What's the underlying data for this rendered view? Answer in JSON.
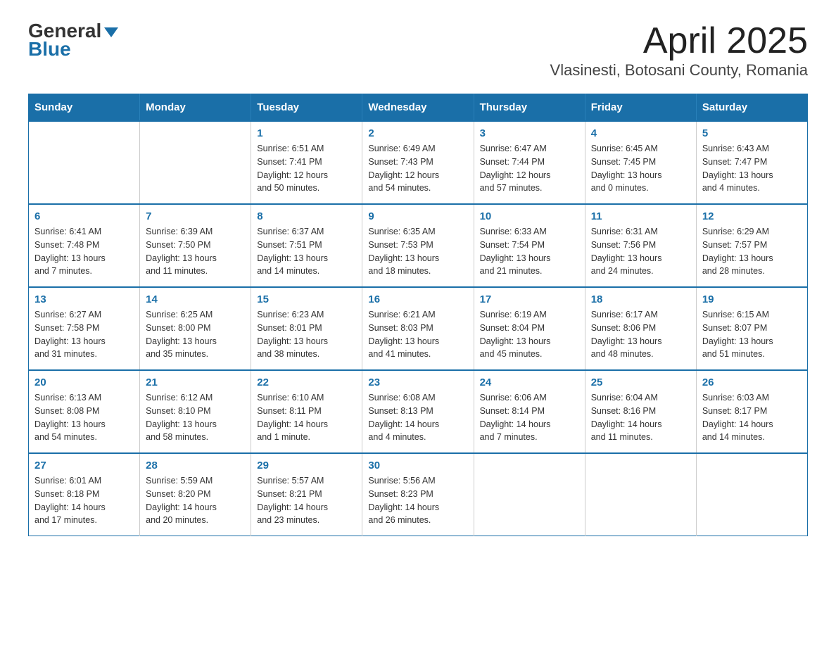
{
  "header": {
    "logo_line1": "General",
    "logo_line2": "Blue",
    "title": "April 2025",
    "subtitle": "Vlasinesti, Botosani County, Romania"
  },
  "calendar": {
    "days_of_week": [
      "Sunday",
      "Monday",
      "Tuesday",
      "Wednesday",
      "Thursday",
      "Friday",
      "Saturday"
    ],
    "weeks": [
      [
        {
          "day": "",
          "info": ""
        },
        {
          "day": "",
          "info": ""
        },
        {
          "day": "1",
          "info": "Sunrise: 6:51 AM\nSunset: 7:41 PM\nDaylight: 12 hours\nand 50 minutes."
        },
        {
          "day": "2",
          "info": "Sunrise: 6:49 AM\nSunset: 7:43 PM\nDaylight: 12 hours\nand 54 minutes."
        },
        {
          "day": "3",
          "info": "Sunrise: 6:47 AM\nSunset: 7:44 PM\nDaylight: 12 hours\nand 57 minutes."
        },
        {
          "day": "4",
          "info": "Sunrise: 6:45 AM\nSunset: 7:45 PM\nDaylight: 13 hours\nand 0 minutes."
        },
        {
          "day": "5",
          "info": "Sunrise: 6:43 AM\nSunset: 7:47 PM\nDaylight: 13 hours\nand 4 minutes."
        }
      ],
      [
        {
          "day": "6",
          "info": "Sunrise: 6:41 AM\nSunset: 7:48 PM\nDaylight: 13 hours\nand 7 minutes."
        },
        {
          "day": "7",
          "info": "Sunrise: 6:39 AM\nSunset: 7:50 PM\nDaylight: 13 hours\nand 11 minutes."
        },
        {
          "day": "8",
          "info": "Sunrise: 6:37 AM\nSunset: 7:51 PM\nDaylight: 13 hours\nand 14 minutes."
        },
        {
          "day": "9",
          "info": "Sunrise: 6:35 AM\nSunset: 7:53 PM\nDaylight: 13 hours\nand 18 minutes."
        },
        {
          "day": "10",
          "info": "Sunrise: 6:33 AM\nSunset: 7:54 PM\nDaylight: 13 hours\nand 21 minutes."
        },
        {
          "day": "11",
          "info": "Sunrise: 6:31 AM\nSunset: 7:56 PM\nDaylight: 13 hours\nand 24 minutes."
        },
        {
          "day": "12",
          "info": "Sunrise: 6:29 AM\nSunset: 7:57 PM\nDaylight: 13 hours\nand 28 minutes."
        }
      ],
      [
        {
          "day": "13",
          "info": "Sunrise: 6:27 AM\nSunset: 7:58 PM\nDaylight: 13 hours\nand 31 minutes."
        },
        {
          "day": "14",
          "info": "Sunrise: 6:25 AM\nSunset: 8:00 PM\nDaylight: 13 hours\nand 35 minutes."
        },
        {
          "day": "15",
          "info": "Sunrise: 6:23 AM\nSunset: 8:01 PM\nDaylight: 13 hours\nand 38 minutes."
        },
        {
          "day": "16",
          "info": "Sunrise: 6:21 AM\nSunset: 8:03 PM\nDaylight: 13 hours\nand 41 minutes."
        },
        {
          "day": "17",
          "info": "Sunrise: 6:19 AM\nSunset: 8:04 PM\nDaylight: 13 hours\nand 45 minutes."
        },
        {
          "day": "18",
          "info": "Sunrise: 6:17 AM\nSunset: 8:06 PM\nDaylight: 13 hours\nand 48 minutes."
        },
        {
          "day": "19",
          "info": "Sunrise: 6:15 AM\nSunset: 8:07 PM\nDaylight: 13 hours\nand 51 minutes."
        }
      ],
      [
        {
          "day": "20",
          "info": "Sunrise: 6:13 AM\nSunset: 8:08 PM\nDaylight: 13 hours\nand 54 minutes."
        },
        {
          "day": "21",
          "info": "Sunrise: 6:12 AM\nSunset: 8:10 PM\nDaylight: 13 hours\nand 58 minutes."
        },
        {
          "day": "22",
          "info": "Sunrise: 6:10 AM\nSunset: 8:11 PM\nDaylight: 14 hours\nand 1 minute."
        },
        {
          "day": "23",
          "info": "Sunrise: 6:08 AM\nSunset: 8:13 PM\nDaylight: 14 hours\nand 4 minutes."
        },
        {
          "day": "24",
          "info": "Sunrise: 6:06 AM\nSunset: 8:14 PM\nDaylight: 14 hours\nand 7 minutes."
        },
        {
          "day": "25",
          "info": "Sunrise: 6:04 AM\nSunset: 8:16 PM\nDaylight: 14 hours\nand 11 minutes."
        },
        {
          "day": "26",
          "info": "Sunrise: 6:03 AM\nSunset: 8:17 PM\nDaylight: 14 hours\nand 14 minutes."
        }
      ],
      [
        {
          "day": "27",
          "info": "Sunrise: 6:01 AM\nSunset: 8:18 PM\nDaylight: 14 hours\nand 17 minutes."
        },
        {
          "day": "28",
          "info": "Sunrise: 5:59 AM\nSunset: 8:20 PM\nDaylight: 14 hours\nand 20 minutes."
        },
        {
          "day": "29",
          "info": "Sunrise: 5:57 AM\nSunset: 8:21 PM\nDaylight: 14 hours\nand 23 minutes."
        },
        {
          "day": "30",
          "info": "Sunrise: 5:56 AM\nSunset: 8:23 PM\nDaylight: 14 hours\nand 26 minutes."
        },
        {
          "day": "",
          "info": ""
        },
        {
          "day": "",
          "info": ""
        },
        {
          "day": "",
          "info": ""
        }
      ]
    ]
  }
}
